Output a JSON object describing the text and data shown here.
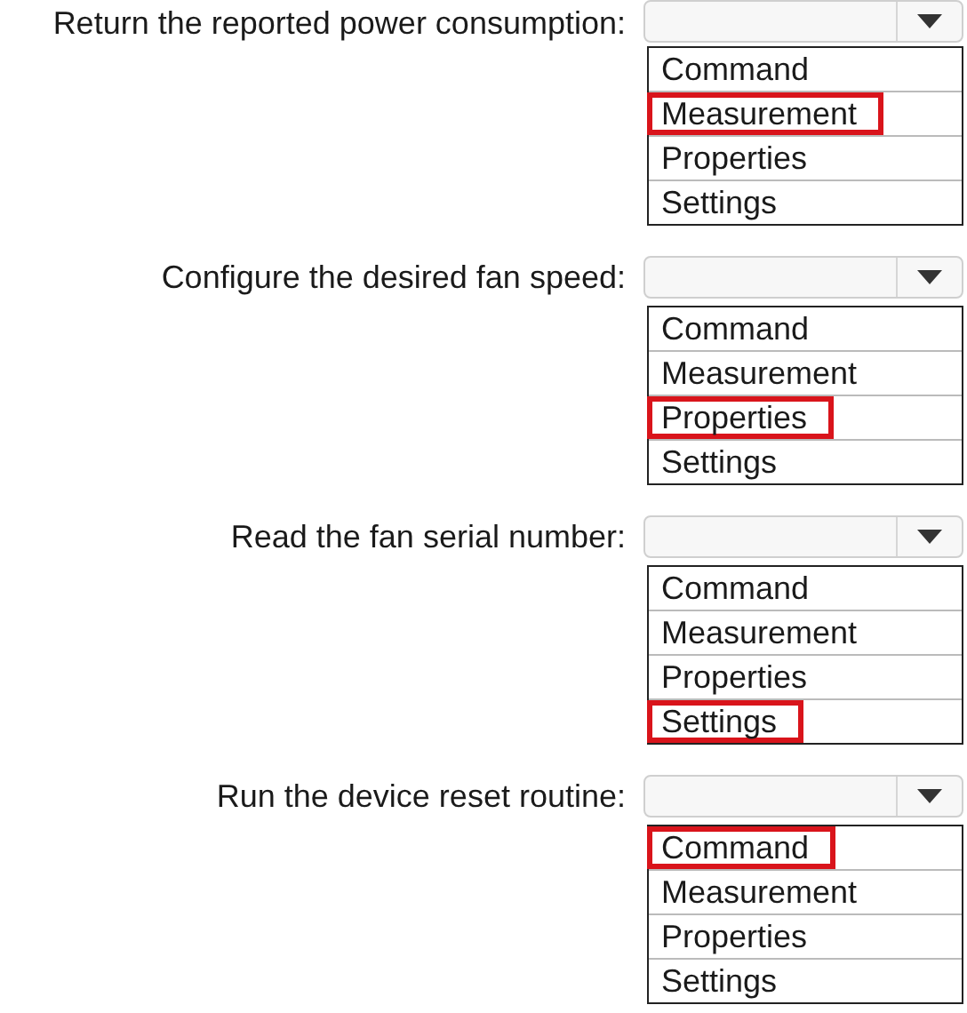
{
  "questions": [
    {
      "prompt": "Return the reported power consumption:",
      "options": [
        {
          "label": "Command",
          "selected": false
        },
        {
          "label": "Measurement",
          "selected": true
        },
        {
          "label": "Properties",
          "selected": false
        },
        {
          "label": "Settings",
          "selected": false
        }
      ]
    },
    {
      "prompt": "Configure the desired fan speed:",
      "options": [
        {
          "label": "Command",
          "selected": false
        },
        {
          "label": "Measurement",
          "selected": false
        },
        {
          "label": "Properties",
          "selected": true
        },
        {
          "label": "Settings",
          "selected": false
        }
      ]
    },
    {
      "prompt": "Read the fan serial number:",
      "options": [
        {
          "label": "Command",
          "selected": false
        },
        {
          "label": "Measurement",
          "selected": false
        },
        {
          "label": "Properties",
          "selected": false
        },
        {
          "label": "Settings",
          "selected": true
        }
      ]
    },
    {
      "prompt": "Run the device reset routine:",
      "options": [
        {
          "label": "Command",
          "selected": true
        },
        {
          "label": "Measurement",
          "selected": false
        },
        {
          "label": "Properties",
          "selected": false
        },
        {
          "label": "Settings",
          "selected": false
        }
      ]
    }
  ]
}
